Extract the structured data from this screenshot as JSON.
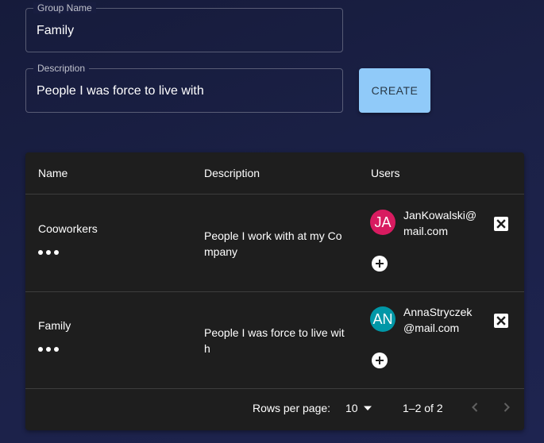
{
  "form": {
    "group_name": {
      "label": "Group Name",
      "value": "Family"
    },
    "description": {
      "label": "Description",
      "value": "People I was force to live with"
    },
    "create_label": "CREATE"
  },
  "table": {
    "headers": {
      "name": "Name",
      "description": "Description",
      "users": "Users"
    },
    "rows": [
      {
        "name": "Cooworkers",
        "description": "People I work with at my Company",
        "users": [
          {
            "initials": "JA",
            "email": "JanKowalski@mail.com",
            "avatar_color": "#d81b60"
          }
        ]
      },
      {
        "name": "Family",
        "description": "People I was force to live with",
        "users": [
          {
            "initials": "AN",
            "email": "AnnaStryczek@mail.com",
            "avatar_color": "#0097a7"
          }
        ]
      }
    ],
    "pagination": {
      "rows_per_page_label": "Rows per page:",
      "rows_per_page": "10",
      "range": "1–2 of 2"
    }
  },
  "colors": {
    "create_button": "#90caf9",
    "table_background": "#1e1e1e",
    "page_background": "#1b2147"
  },
  "icons": {
    "more": "more-horiz-icon",
    "remove": "close-box-icon",
    "add": "add-circle-icon",
    "dropdown": "caret-down-icon",
    "prev": "chevron-left-icon",
    "next": "chevron-right-icon"
  }
}
